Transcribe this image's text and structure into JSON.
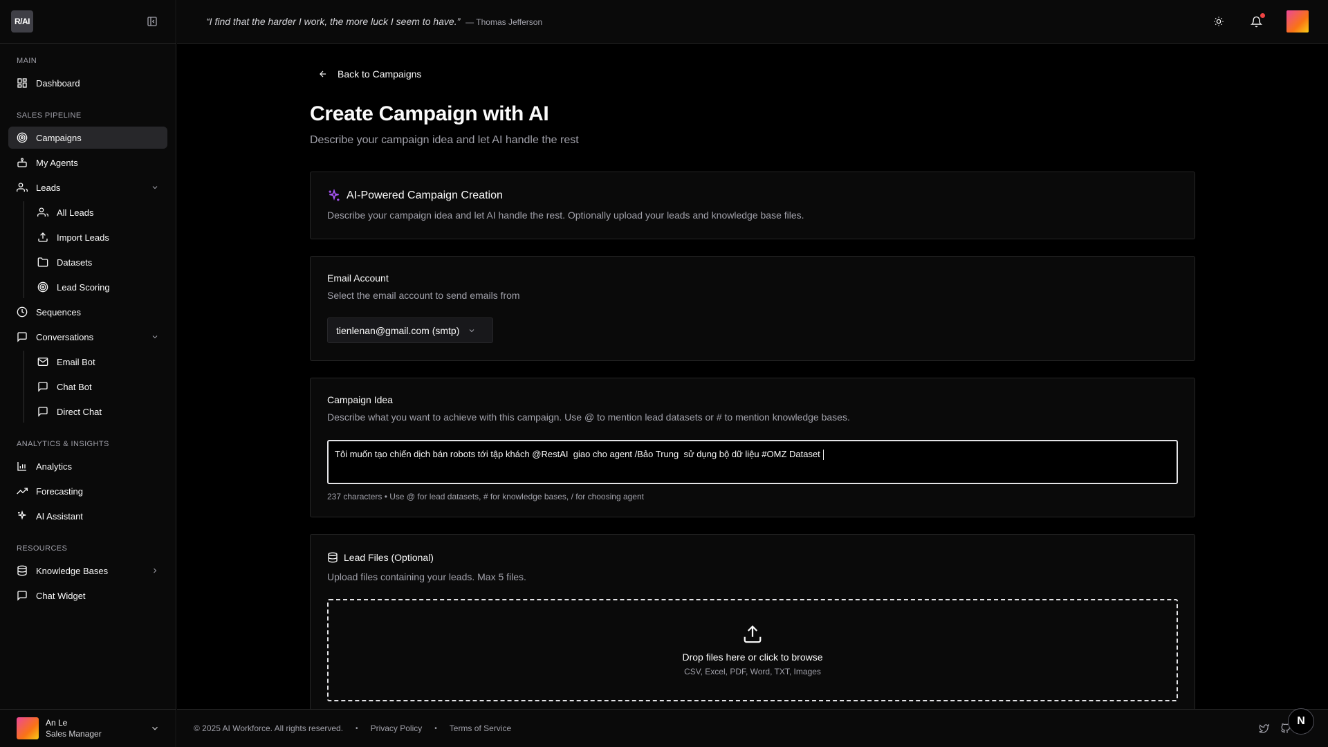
{
  "sidebar": {
    "logo_text": "R/AI",
    "sections": {
      "main": "MAIN",
      "sales": "SALES PIPELINE",
      "analytics": "ANALYTICS & INSIGHTS",
      "resources": "RESOURCES"
    },
    "items": {
      "dashboard": "Dashboard",
      "campaigns": "Campaigns",
      "my_agents": "My Agents",
      "leads": "Leads",
      "all_leads": "All Leads",
      "import_leads": "Import Leads",
      "datasets": "Datasets",
      "lead_scoring": "Lead Scoring",
      "sequences": "Sequences",
      "conversations": "Conversations",
      "email_bot": "Email Bot",
      "chat_bot": "Chat Bot",
      "direct_chat": "Direct Chat",
      "analytics": "Analytics",
      "forecasting": "Forecasting",
      "ai_assistant": "AI Assistant",
      "knowledge_bases": "Knowledge Bases",
      "chat_widget": "Chat Widget"
    },
    "user": {
      "name": "An Le",
      "role": "Sales Manager"
    },
    "active_item": "Campaigns"
  },
  "topbar": {
    "quote": "“I find that the harder I work, the more luck I seem to have.”",
    "author": "— Thomas Jefferson",
    "has_notification": true
  },
  "page": {
    "back_label": "Back to Campaigns",
    "title": "Create Campaign with AI",
    "subtitle": "Describe your campaign idea and let AI handle the rest"
  },
  "ai_card": {
    "title": "AI-Powered Campaign Creation",
    "description": "Describe your campaign idea and let AI handle the rest. Optionally upload your leads and knowledge base files."
  },
  "email_card": {
    "title": "Email Account",
    "description": "Select the email account to send emails from",
    "selected": "tienlenan@gmail.com (smtp)"
  },
  "idea_card": {
    "title": "Campaign Idea",
    "description": "Describe what you want to achieve with this campaign. Use @ to mention lead datasets or # to mention knowledge bases.",
    "value": "Tôi muốn tạo chiến dịch bán robots tới tập khách @RestAI  giao cho agent /Bảo Trung  sử dụng bộ dữ liệu #OMZ Dataset",
    "hint": "237 characters • Use @ for lead datasets, # for knowledge bases, / for choosing agent"
  },
  "files_card": {
    "title": "Lead Files (Optional)",
    "description": "Upload files containing your leads. Max 5 files.",
    "drop_title": "Drop files here or click to browse",
    "drop_sub": "CSV, Excel, PDF, Word, TXT, Images"
  },
  "footer": {
    "copyright": "© 2025 AI Workforce. All rights reserved.",
    "privacy": "Privacy Policy",
    "terms": "Terms of Service",
    "separator": "•",
    "badge": "N"
  },
  "colors": {
    "accent_purple": "#a855f7",
    "notification_dot": "#ef4444"
  }
}
